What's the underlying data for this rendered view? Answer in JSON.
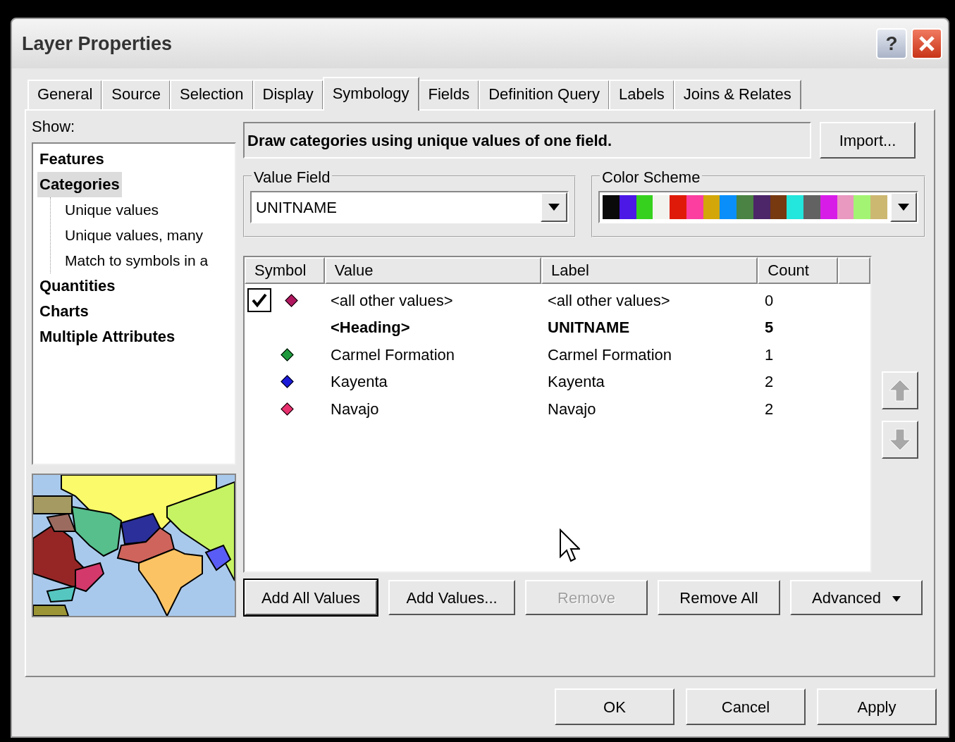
{
  "window": {
    "title": "Layer Properties",
    "help": "?"
  },
  "tabs": [
    {
      "label": "General",
      "selected": false
    },
    {
      "label": "Source",
      "selected": false
    },
    {
      "label": "Selection",
      "selected": false
    },
    {
      "label": "Display",
      "selected": false
    },
    {
      "label": "Symbology",
      "selected": true
    },
    {
      "label": "Fields",
      "selected": false
    },
    {
      "label": "Definition Query",
      "selected": false
    },
    {
      "label": "Labels",
      "selected": false
    },
    {
      "label": "Joins & Relates",
      "selected": false
    }
  ],
  "show": {
    "label": "Show:",
    "items": [
      {
        "label": "Features",
        "selected": false
      },
      {
        "label": "Categories",
        "selected": true,
        "children": [
          {
            "label": "Unique values",
            "selected": false
          },
          {
            "label": "Unique values, many",
            "selected": false
          },
          {
            "label": "Match to symbols in a",
            "selected": false
          }
        ]
      },
      {
        "label": "Quantities",
        "selected": false
      },
      {
        "label": "Charts",
        "selected": false
      },
      {
        "label": "Multiple Attributes",
        "selected": false
      }
    ]
  },
  "description": "Draw categories using unique values of one field.",
  "import_button": "Import...",
  "value_field": {
    "legend": "Value Field",
    "value": "UNITNAME"
  },
  "color_scheme": {
    "legend": "Color Scheme",
    "swatches": [
      {
        "color": "#0a0a0a"
      },
      {
        "color": "#4b18e6"
      },
      {
        "color": "#36d11f"
      },
      {
        "color": "#f2f2ee"
      },
      {
        "color": "#e01a08"
      },
      {
        "color": "#fb3ea0"
      },
      {
        "color": "#d3a70a"
      },
      {
        "color": "#0a8ffa"
      },
      {
        "color": "#4a8343"
      },
      {
        "color": "#4c2668"
      },
      {
        "color": "#763910"
      },
      {
        "color": "#23e6dc"
      },
      {
        "color": "#626262"
      },
      {
        "color": "#d81ce8"
      },
      {
        "color": "#e998c0"
      },
      {
        "color": "#a4f474"
      },
      {
        "color": "#cdb872"
      }
    ]
  },
  "table": {
    "columns": [
      "Symbol",
      "Value",
      "Label",
      "Count"
    ],
    "rows": [
      {
        "kind": "other",
        "checked": true,
        "color": "#b0175f",
        "value": "<all other values>",
        "label": "<all other values>",
        "count": "0"
      },
      {
        "kind": "heading",
        "value": "<Heading>",
        "label": "UNITNAME",
        "count": "5"
      },
      {
        "kind": "value",
        "color": "#1e9a3c",
        "value": "Carmel Formation",
        "label": "Carmel Formation",
        "count": "1"
      },
      {
        "kind": "value",
        "color": "#1a1ad8",
        "value": "Kayenta",
        "label": "Kayenta",
        "count": "2"
      },
      {
        "kind": "value",
        "color": "#e8306e",
        "value": "Navajo",
        "label": "Navajo",
        "count": "2"
      }
    ]
  },
  "actions": [
    {
      "label": "Add All Values",
      "disabled": false,
      "default": true,
      "menu": false
    },
    {
      "label": "Add Values...",
      "disabled": false,
      "default": false,
      "menu": false
    },
    {
      "label": "Remove",
      "disabled": true,
      "default": false,
      "menu": false
    },
    {
      "label": "Remove All",
      "disabled": false,
      "default": false,
      "menu": false
    },
    {
      "label": "Advanced",
      "disabled": false,
      "default": false,
      "menu": true
    }
  ],
  "footer_buttons": [
    "OK",
    "Cancel",
    "Apply"
  ]
}
